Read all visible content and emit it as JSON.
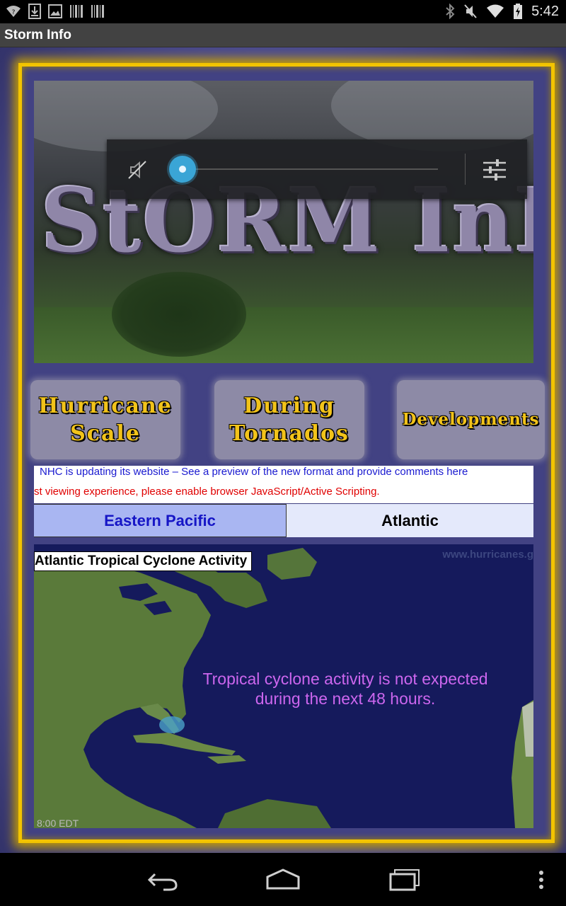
{
  "status_bar": {
    "time": "5:42",
    "left_icons": [
      "wifi-question-icon",
      "download-icon",
      "image-icon",
      "barcode-icon",
      "barcode-icon"
    ],
    "right_icons": [
      "bluetooth-icon",
      "mute-icon",
      "wifi-icon",
      "battery-icon"
    ]
  },
  "app_bar": {
    "title": "Storm Info"
  },
  "hero": {
    "logo_text": "StORM InFO"
  },
  "volume_panel": {
    "level": 0,
    "mute_icon": "speaker-muted-icon",
    "settings_icon": "sliders-icon"
  },
  "nav_buttons": [
    {
      "line1": "Hurricane",
      "line2": "Scale"
    },
    {
      "line1": "During",
      "line2": "Tornados"
    },
    {
      "line1": "Developments",
      "line2": ""
    }
  ],
  "nhc_notice": {
    "line1": "NHC is updating its website – See a preview of the new format and provide comments here",
    "line2": "st viewing experience, please enable browser JavaScript/Active Scripting."
  },
  "tabs": [
    {
      "label": "Eastern Pacific",
      "selected": false
    },
    {
      "label": "Atlantic",
      "selected": true
    }
  ],
  "map": {
    "title": "Atlantic Tropical Cyclone Activity",
    "watermark": "www.hurricanes.g",
    "message_line1": "Tropical cyclone activity is not expected",
    "message_line2": "during the next 48 hours.",
    "timestamp": "8:00     EDT"
  },
  "colors": {
    "frame_gold": "#f3c400",
    "frame_blue": "#424283",
    "button_text": "#f2c31a",
    "tab_selected_bg": "#e4e9fb",
    "tab_unselected_bg": "#a9b6f2",
    "map_message": "#cc66ee"
  },
  "nav_bar": {
    "icons": [
      "back-icon",
      "home-icon",
      "recents-icon",
      "overflow-menu-icon"
    ]
  }
}
